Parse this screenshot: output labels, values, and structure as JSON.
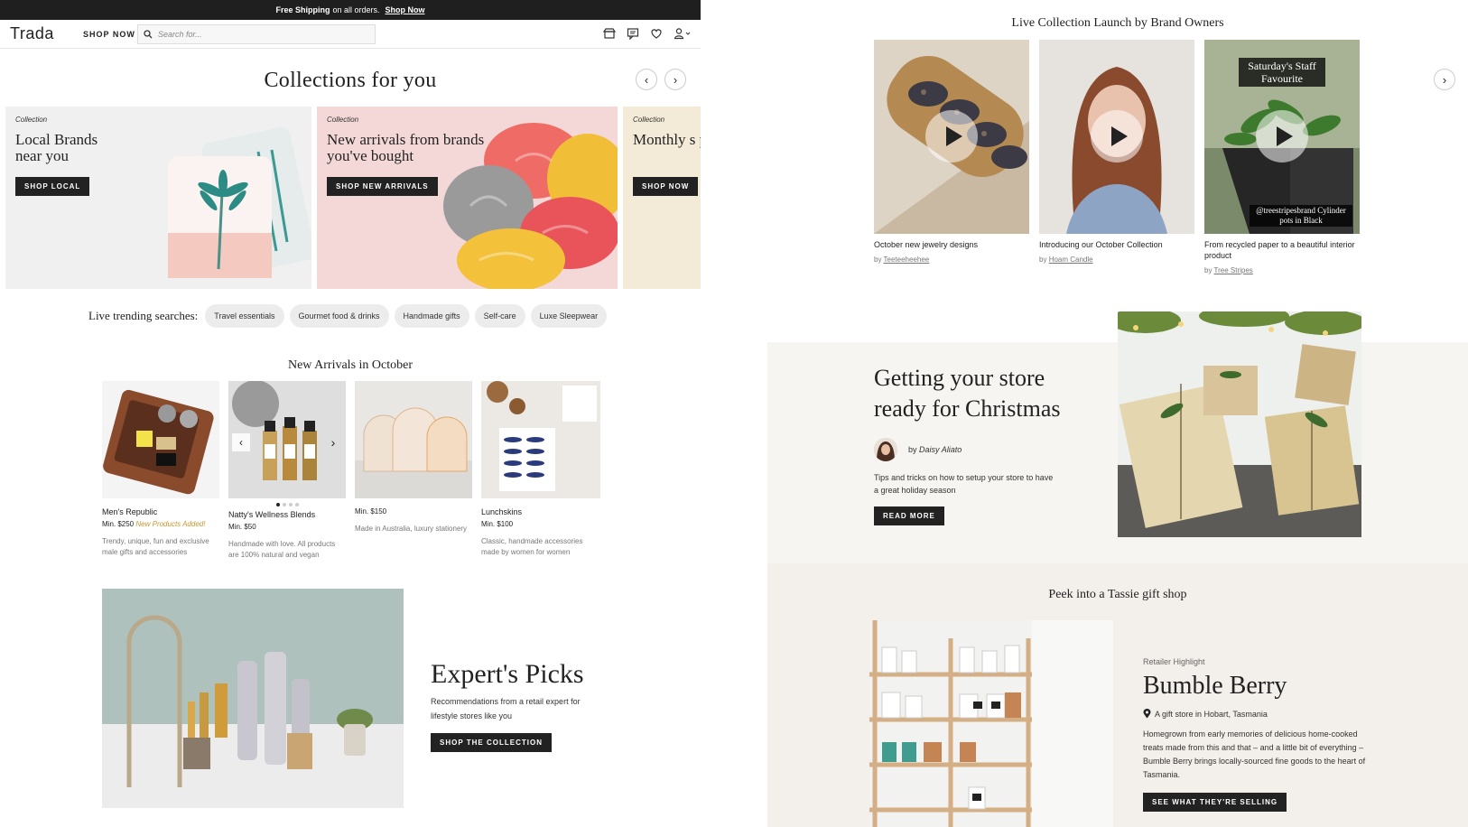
{
  "announcement": {
    "bold": "Free Shipping",
    "text": "on all orders.",
    "link": "Shop Now"
  },
  "nav": {
    "logo": "Trada",
    "shop_now": "SHOP NOW",
    "search_placeholder": "Search for..."
  },
  "collections": {
    "heading": "Collections for you",
    "cards": [
      {
        "tag": "Collection",
        "title": "Local Brands near you",
        "cta": "SHOP LOCAL"
      },
      {
        "tag": "Collection",
        "title": "New arrivals from brands you've bought",
        "cta": "SHOP NEW ARRIVALS"
      },
      {
        "tag": "Collection",
        "title": "Monthly s picks",
        "cta": "SHOP NOW"
      }
    ]
  },
  "trending": {
    "label": "Live trending searches:",
    "pills": [
      "Travel essentials",
      "Gourmet food & drinks",
      "Handmade gifts",
      "Self-care",
      "Luxe Sleepwear"
    ]
  },
  "new_arrivals": {
    "heading": "New Arrivals in October",
    "products": [
      {
        "name": "Men's Republic",
        "min": "Min. $250",
        "badge": "New Products Added!",
        "desc": "Trendy, unique, fun and exclusive male gifts and accessories"
      },
      {
        "name": "Natty's Wellness Blends",
        "min": "Min. $50",
        "badge": "",
        "desc": "Handmade with love. All products are 100% natural and vegan"
      },
      {
        "name": "",
        "min": "Min. $150",
        "badge": "",
        "desc": "Made in Australia, luxury stationery"
      },
      {
        "name": "Lunchskins",
        "min": "Min. $100",
        "badge": "",
        "desc": "Classic, handmade accessories made by women for women"
      }
    ]
  },
  "experts": {
    "title": "Expert's Picks",
    "desc": "Recommendations from a retail expert for lifestyle stores like you",
    "cta": "SHOP THE COLLECTION"
  },
  "live": {
    "heading": "Live Collection Launch by Brand Owners",
    "videos": [
      {
        "caption": "October new jewelry designs",
        "by": "by",
        "brand": "Teeteeheehee",
        "overlay": ""
      },
      {
        "caption": "Introducing our October Collection",
        "by": "by",
        "brand": "Hoam Candle",
        "overlay": ""
      },
      {
        "caption": "From recycled paper to a beautiful interior product",
        "by": "by",
        "brand": "Tree Stripes",
        "overlay": "Saturday's Staff Favourite",
        "overlay2": "@treestripesbrand Cylinder pots in Black"
      }
    ]
  },
  "christmas": {
    "title": "Getting your store ready for Christmas",
    "author_prefix": "by",
    "author": "Daisy Aliato",
    "desc": "Tips and tricks on how to setup your store to have a great holiday season",
    "cta": "READ MORE"
  },
  "tassie": {
    "heading": "Peek into a Tassie gift shop",
    "tag": "Retailer Highlight",
    "title": "Bumble Berry",
    "location": "A gift store in Hobart, Tasmania",
    "desc": "Homegrown from early memories of delicious home-cooked treats made from this and that – and a little bit of everything – Bumble Berry brings locally-sourced fine goods to the heart of Tasmania.",
    "cta": "SEE WHAT THEY'RE SELLING"
  },
  "colors": {
    "dark": "#222222",
    "accent_gold": "#c8962e",
    "panel_bg": "#f7f5f2",
    "tassie_bg": "#f3efea"
  }
}
